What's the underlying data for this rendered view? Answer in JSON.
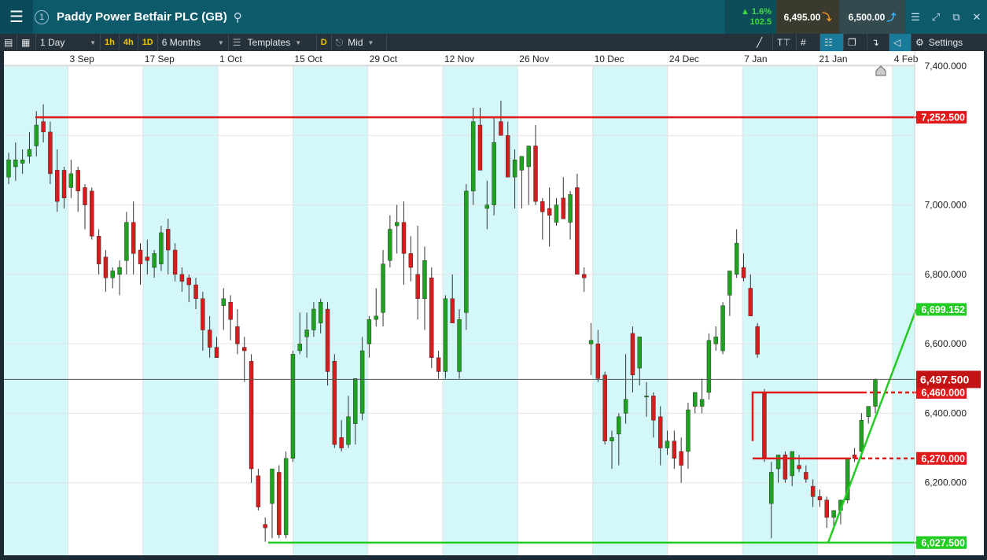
{
  "header": {
    "instrument": "Paddy Power Betfair PLC (GB)",
    "workspace_number": "1",
    "change_percent": "1.6%",
    "change_points": "102.5",
    "sell_price": "6,495.00",
    "buy_price": "6,500.00"
  },
  "toolbar": {
    "interval": "1 Day",
    "quick_intervals": [
      "1h",
      "4h",
      "1D"
    ],
    "range": "6 Months",
    "templates_label": "Templates",
    "d_label": "D",
    "price_type": "Mid",
    "settings_label": "Settings"
  },
  "colors": {
    "up": "#1fa21f",
    "down": "#d61c1c",
    "resistance": "#e01a1a",
    "support": "#22cc22",
    "shade": "#d4f7fa",
    "current": "#c21414"
  },
  "chart_data": {
    "type": "candlestick",
    "y_ticks": [
      "7,400.000",
      "7,000.000",
      "6,800.000",
      "6,600.000",
      "6,400.000",
      "6,200.000"
    ],
    "ylim": [
      6000,
      7400
    ],
    "x_labels": [
      "3 Sep",
      "17 Sep",
      "1 Oct",
      "15 Oct",
      "29 Oct",
      "12 Nov",
      "26 Nov",
      "10 Dec",
      "24 Dec",
      "7 Jan",
      "21 Jan",
      "4 Feb"
    ],
    "candles": [
      {
        "o": 7080,
        "h": 7150,
        "l": 7060,
        "c": 7130
      },
      {
        "o": 7110,
        "h": 7180,
        "l": 7070,
        "c": 7130
      },
      {
        "o": 7120,
        "h": 7160,
        "l": 7090,
        "c": 7130
      },
      {
        "o": 7140,
        "h": 7210,
        "l": 7120,
        "c": 7160
      },
      {
        "o": 7170,
        "h": 7270,
        "l": 7140,
        "c": 7230
      },
      {
        "o": 7240,
        "h": 7290,
        "l": 7180,
        "c": 7210
      },
      {
        "o": 7210,
        "h": 7240,
        "l": 7060,
        "c": 7090
      },
      {
        "o": 7100,
        "h": 7160,
        "l": 6980,
        "c": 7010
      },
      {
        "o": 7100,
        "h": 7110,
        "l": 6990,
        "c": 7020
      },
      {
        "o": 7050,
        "h": 7130,
        "l": 7020,
        "c": 7090
      },
      {
        "o": 7100,
        "h": 7110,
        "l": 6980,
        "c": 7040
      },
      {
        "o": 7050,
        "h": 7060,
        "l": 6930,
        "c": 7000
      },
      {
        "o": 7040,
        "h": 7050,
        "l": 6900,
        "c": 6910
      },
      {
        "o": 6910,
        "h": 6930,
        "l": 6800,
        "c": 6830
      },
      {
        "o": 6850,
        "h": 6870,
        "l": 6750,
        "c": 6790
      },
      {
        "o": 6790,
        "h": 6820,
        "l": 6760,
        "c": 6810
      },
      {
        "o": 6800,
        "h": 6840,
        "l": 6740,
        "c": 6820
      },
      {
        "o": 6840,
        "h": 6980,
        "l": 6800,
        "c": 6950
      },
      {
        "o": 6950,
        "h": 7010,
        "l": 6800,
        "c": 6860
      },
      {
        "o": 6870,
        "h": 6890,
        "l": 6770,
        "c": 6830
      },
      {
        "o": 6850,
        "h": 6900,
        "l": 6800,
        "c": 6840
      },
      {
        "o": 6820,
        "h": 6870,
        "l": 6790,
        "c": 6860
      },
      {
        "o": 6830,
        "h": 6940,
        "l": 6810,
        "c": 6920
      },
      {
        "o": 6930,
        "h": 6960,
        "l": 6800,
        "c": 6870
      },
      {
        "o": 6870,
        "h": 6890,
        "l": 6780,
        "c": 6800
      },
      {
        "o": 6800,
        "h": 6820,
        "l": 6750,
        "c": 6780
      },
      {
        "o": 6790,
        "h": 6800,
        "l": 6720,
        "c": 6770
      },
      {
        "o": 6770,
        "h": 6790,
        "l": 6700,
        "c": 6730
      },
      {
        "o": 6730,
        "h": 6750,
        "l": 6580,
        "c": 6640
      },
      {
        "o": 6640,
        "h": 6680,
        "l": 6560,
        "c": 6590
      },
      {
        "o": 6590,
        "h": 6620,
        "l": 6560,
        "c": 6560
      },
      {
        "o": 6710,
        "h": 6760,
        "l": 6640,
        "c": 6730
      },
      {
        "o": 6720,
        "h": 6740,
        "l": 6610,
        "c": 6670
      },
      {
        "o": 6650,
        "h": 6700,
        "l": 6570,
        "c": 6600
      },
      {
        "o": 6590,
        "h": 6620,
        "l": 6490,
        "c": 6580
      },
      {
        "o": 6550,
        "h": 6570,
        "l": 6200,
        "c": 6240
      },
      {
        "o": 6220,
        "h": 6240,
        "l": 6120,
        "c": 6130
      },
      {
        "o": 6080,
        "h": 6100,
        "l": 6030,
        "c": 6070
      },
      {
        "o": 6140,
        "h": 6180,
        "l": 6040,
        "c": 6240
      },
      {
        "o": 6230,
        "h": 6250,
        "l": 6040,
        "c": 6050
      },
      {
        "o": 6050,
        "h": 6290,
        "l": 6040,
        "c": 6270
      },
      {
        "o": 6270,
        "h": 6580,
        "l": 6260,
        "c": 6570
      },
      {
        "o": 6580,
        "h": 6690,
        "l": 6570,
        "c": 6600
      },
      {
        "o": 6620,
        "h": 6690,
        "l": 6560,
        "c": 6640
      },
      {
        "o": 6640,
        "h": 6720,
        "l": 6620,
        "c": 6700
      },
      {
        "o": 6660,
        "h": 6730,
        "l": 6630,
        "c": 6720
      },
      {
        "o": 6700,
        "h": 6720,
        "l": 6480,
        "c": 6520
      },
      {
        "o": 6550,
        "h": 6570,
        "l": 6300,
        "c": 6310
      },
      {
        "o": 6330,
        "h": 6380,
        "l": 6290,
        "c": 6300
      },
      {
        "o": 6310,
        "h": 6450,
        "l": 6300,
        "c": 6390
      },
      {
        "o": 6370,
        "h": 6490,
        "l": 6310,
        "c": 6500
      },
      {
        "o": 6400,
        "h": 6620,
        "l": 6380,
        "c": 6580
      },
      {
        "o": 6600,
        "h": 6680,
        "l": 6560,
        "c": 6670
      },
      {
        "o": 6670,
        "h": 6760,
        "l": 6650,
        "c": 6680
      },
      {
        "o": 6690,
        "h": 6870,
        "l": 6650,
        "c": 6830
      },
      {
        "o": 6840,
        "h": 6970,
        "l": 6820,
        "c": 6930
      },
      {
        "o": 6940,
        "h": 7000,
        "l": 6860,
        "c": 6950
      },
      {
        "o": 6950,
        "h": 7010,
        "l": 6770,
        "c": 6860
      },
      {
        "o": 6860,
        "h": 6910,
        "l": 6780,
        "c": 6820
      },
      {
        "o": 6800,
        "h": 6940,
        "l": 6670,
        "c": 6730
      },
      {
        "o": 6730,
        "h": 6880,
        "l": 6640,
        "c": 6840
      },
      {
        "o": 6790,
        "h": 6820,
        "l": 6530,
        "c": 6560
      },
      {
        "o": 6560,
        "h": 6580,
        "l": 6500,
        "c": 6520
      },
      {
        "o": 6520,
        "h": 6740,
        "l": 6500,
        "c": 6730
      },
      {
        "o": 6730,
        "h": 6800,
        "l": 6670,
        "c": 6660
      },
      {
        "o": 6520,
        "h": 6700,
        "l": 6500,
        "c": 6670
      },
      {
        "o": 6690,
        "h": 7060,
        "l": 6640,
        "c": 7040
      },
      {
        "o": 7040,
        "h": 7280,
        "l": 7000,
        "c": 7240
      },
      {
        "o": 7230,
        "h": 7280,
        "l": 7100,
        "c": 7100
      },
      {
        "o": 6990,
        "h": 7070,
        "l": 6930,
        "c": 7000
      },
      {
        "o": 7000,
        "h": 7250,
        "l": 6970,
        "c": 7180
      },
      {
        "o": 7240,
        "h": 7300,
        "l": 7200,
        "c": 7200
      },
      {
        "o": 7200,
        "h": 7240,
        "l": 7080,
        "c": 7080
      },
      {
        "o": 7080,
        "h": 7160,
        "l": 6990,
        "c": 7130
      },
      {
        "o": 7100,
        "h": 7140,
        "l": 6990,
        "c": 7140
      },
      {
        "o": 7110,
        "h": 7170,
        "l": 7000,
        "c": 7170
      },
      {
        "o": 7170,
        "h": 7230,
        "l": 7000,
        "c": 7010
      },
      {
        "o": 7010,
        "h": 7020,
        "l": 6900,
        "c": 6980
      },
      {
        "o": 6990,
        "h": 7050,
        "l": 6880,
        "c": 6970
      },
      {
        "o": 6950,
        "h": 7020,
        "l": 6940,
        "c": 7000
      },
      {
        "o": 7020,
        "h": 7080,
        "l": 6960,
        "c": 6960
      },
      {
        "o": 6950,
        "h": 7040,
        "l": 6900,
        "c": 7030
      },
      {
        "o": 7050,
        "h": 7090,
        "l": 6800,
        "c": 6800
      },
      {
        "o": 6800,
        "h": 6820,
        "l": 6750,
        "c": 6790
      },
      {
        "o": 6600,
        "h": 6660,
        "l": 6510,
        "c": 6610
      },
      {
        "o": 6600,
        "h": 6640,
        "l": 6490,
        "c": 6500
      },
      {
        "o": 6510,
        "h": 6520,
        "l": 6310,
        "c": 6320
      },
      {
        "o": 6320,
        "h": 6350,
        "l": 6240,
        "c": 6330
      },
      {
        "o": 6340,
        "h": 6400,
        "l": 6250,
        "c": 6390
      },
      {
        "o": 6400,
        "h": 6570,
        "l": 6370,
        "c": 6440
      },
      {
        "o": 6630,
        "h": 6650,
        "l": 6460,
        "c": 6510
      },
      {
        "o": 6530,
        "h": 6620,
        "l": 6480,
        "c": 6620
      },
      {
        "o": 6450,
        "h": 6490,
        "l": 6390,
        "c": 6450
      },
      {
        "o": 6450,
        "h": 6460,
        "l": 6330,
        "c": 6380
      },
      {
        "o": 6390,
        "h": 6420,
        "l": 6250,
        "c": 6300
      },
      {
        "o": 6300,
        "h": 6350,
        "l": 6280,
        "c": 6320
      },
      {
        "o": 6320,
        "h": 6350,
        "l": 6240,
        "c": 6270
      },
      {
        "o": 6290,
        "h": 6330,
        "l": 6200,
        "c": 6250
      },
      {
        "o": 6290,
        "h": 6430,
        "l": 6240,
        "c": 6410
      },
      {
        "o": 6420,
        "h": 6460,
        "l": 6400,
        "c": 6460
      },
      {
        "o": 6420,
        "h": 6500,
        "l": 6400,
        "c": 6440
      },
      {
        "o": 6460,
        "h": 6630,
        "l": 6440,
        "c": 6610
      },
      {
        "o": 6600,
        "h": 6650,
        "l": 6580,
        "c": 6620
      },
      {
        "o": 6580,
        "h": 6720,
        "l": 6570,
        "c": 6710
      },
      {
        "o": 6740,
        "h": 6790,
        "l": 6680,
        "c": 6810
      },
      {
        "o": 6800,
        "h": 6930,
        "l": 6790,
        "c": 6890
      },
      {
        "o": 6820,
        "h": 6860,
        "l": 6780,
        "c": 6790
      },
      {
        "o": 6760,
        "h": 6800,
        "l": 6680,
        "c": 6680
      },
      {
        "o": 6650,
        "h": 6660,
        "l": 6560,
        "c": 6570
      },
      {
        "o": 6460,
        "h": 6470,
        "l": 6260,
        "c": 6270
      },
      {
        "o": 6140,
        "h": 6260,
        "l": 6040,
        "c": 6230
      },
      {
        "o": 6240,
        "h": 6280,
        "l": 6200,
        "c": 6280
      },
      {
        "o": 6280,
        "h": 6290,
        "l": 6200,
        "c": 6210
      },
      {
        "o": 6220,
        "h": 6290,
        "l": 6190,
        "c": 6290
      },
      {
        "o": 6250,
        "h": 6280,
        "l": 6230,
        "c": 6240
      },
      {
        "o": 6230,
        "h": 6250,
        "l": 6200,
        "c": 6210
      },
      {
        "o": 6190,
        "h": 6210,
        "l": 6130,
        "c": 6160
      },
      {
        "o": 6160,
        "h": 6180,
        "l": 6130,
        "c": 6150
      },
      {
        "o": 6150,
        "h": 6160,
        "l": 6070,
        "c": 6100
      },
      {
        "o": 6100,
        "h": 6110,
        "l": 6070,
        "c": 6120
      },
      {
        "o": 6120,
        "h": 6150,
        "l": 6080,
        "c": 6150
      },
      {
        "o": 6150,
        "h": 6270,
        "l": 6140,
        "c": 6270
      },
      {
        "o": 6280,
        "h": 6300,
        "l": 6260,
        "c": 6270
      },
      {
        "o": 6290,
        "h": 6400,
        "l": 6270,
        "c": 6380
      },
      {
        "o": 6390,
        "h": 6420,
        "l": 6370,
        "c": 6420
      },
      {
        "o": 6420,
        "h": 6500,
        "l": 6400,
        "c": 6497
      }
    ],
    "levels": [
      {
        "value": 7252.5,
        "label": "7,252.500",
        "color": "#e01a1a"
      },
      {
        "value": 6027.5,
        "label": "6,027.500",
        "color": "#22cc22"
      },
      {
        "value": 6460,
        "label": "6,460.000",
        "color": "#e01a1a"
      },
      {
        "value": 6270,
        "label": "6,270.000",
        "color": "#e01a1a"
      },
      {
        "value": 6699.152,
        "label": "6,699.152",
        "color": "#22cc22"
      }
    ],
    "current_price": {
      "value": 6497.5,
      "label": "6,497.500"
    }
  }
}
